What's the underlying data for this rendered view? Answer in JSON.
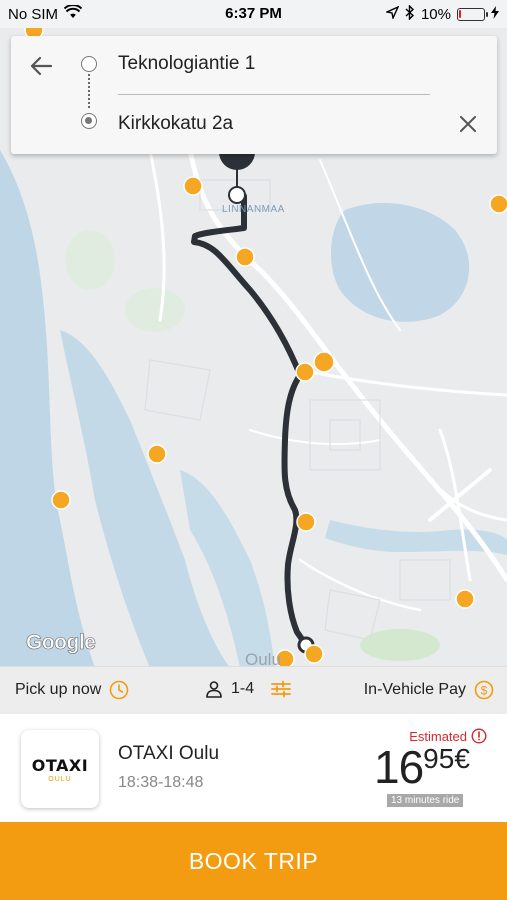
{
  "status_bar": {
    "carrier": "No SIM",
    "time": "6:37 PM",
    "battery_percent": "10%",
    "battery_level": 0.1,
    "icons": [
      "wifi-icon",
      "location-arrow-icon",
      "bluetooth-icon",
      "battery-icon",
      "charging-icon"
    ]
  },
  "route": {
    "origin": "Teknologiantie 1",
    "destination": "Kirkkokatu 2a"
  },
  "map": {
    "labels": {
      "linnanmaa": "LINNANMAA",
      "oulu": "Oulu"
    },
    "attribution": "Google",
    "marker_color": "#f5a623",
    "route_color": "#2b3137"
  },
  "options": {
    "pickup": "Pick up now",
    "passengers": "1-4",
    "payment": "In-Vehicle Pay",
    "accent": "#f39c12"
  },
  "taxi": {
    "logo_main": "OTAXI",
    "logo_sub": "OULU",
    "name": "OTAXI Oulu",
    "time_window": "18:38-18:48",
    "estimated_label": "Estimated",
    "price_main": "16",
    "price_decimal": "95€",
    "duration": "13 minutes ride"
  },
  "book_button": {
    "label": "BOOK TRIP",
    "color": "#f39c12"
  }
}
